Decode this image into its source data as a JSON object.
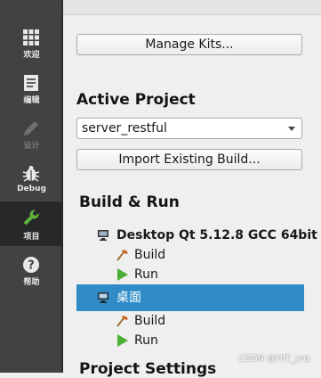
{
  "sidebar": {
    "modes": [
      {
        "label": "欢迎",
        "icon": "grid-icon"
      },
      {
        "label": "编辑",
        "icon": "document-icon"
      },
      {
        "label": "设计",
        "icon": "pencil-icon"
      },
      {
        "label": "Debug",
        "icon": "bug-icon"
      },
      {
        "label": "项目",
        "icon": "wrench-icon"
      },
      {
        "label": "帮助",
        "icon": "help-icon"
      }
    ],
    "active_mode": "项目",
    "colors": {
      "background": "#404244",
      "active": "#272829"
    }
  },
  "main": {
    "manage_kits_label": "Manage Kits...",
    "active_project_heading": "Active Project",
    "project_combo_value": "server_restful",
    "import_build_label": "Import Existing Build...",
    "build_run_heading": "Build & Run",
    "kits": [
      {
        "name": "Desktop Qt 5.12.8 GCC 64bit",
        "build_label": "Build",
        "run_label": "Run",
        "selected": false
      },
      {
        "name": "桌面",
        "build_label": "Build",
        "run_label": "Run",
        "selected": true
      }
    ],
    "project_settings_heading": "Project Settings",
    "selection_color": "#308cc6"
  },
  "watermark": "CSDN @HIT_yrq"
}
